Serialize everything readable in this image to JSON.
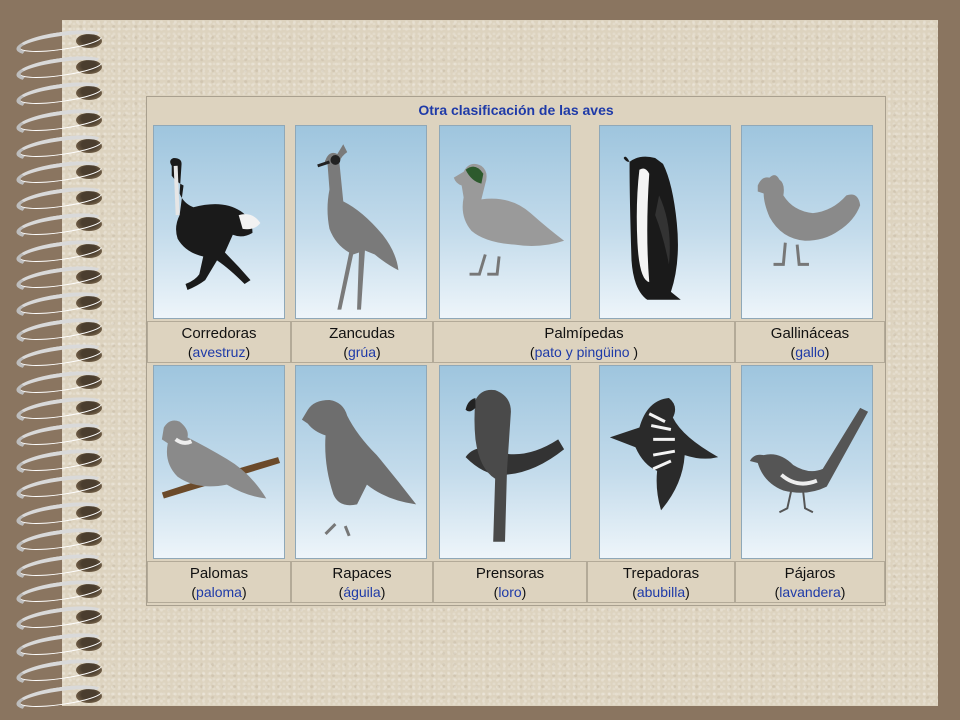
{
  "title": "Otra clasificación de las aves",
  "row1": [
    {
      "name": "Corredoras",
      "example": "avestruz",
      "icon": "ostrich-icon"
    },
    {
      "name": "Zancudas",
      "example": "grúa",
      "icon": "crane-icon"
    },
    {
      "name": "Palmípedas",
      "example": "pato y pingüino ",
      "icon": "duck-icon"
    },
    {
      "name": "Gallináceas",
      "example": "gallo",
      "icon": "rooster-icon"
    }
  ],
  "row1_extra_icon": "penguin-icon",
  "row2": [
    {
      "name": "Palomas",
      "example": "paloma",
      "icon": "pigeon-icon"
    },
    {
      "name": "Rapaces",
      "example": "águila",
      "icon": "eagle-icon"
    },
    {
      "name": "Prensoras",
      "example": "loro",
      "icon": "parrot-icon"
    },
    {
      "name": "Trepadoras",
      "example": "abubilla",
      "icon": "hoopoe-icon"
    },
    {
      "name": "Pájaros",
      "example": "lavandera",
      "icon": "wagtail-icon"
    }
  ],
  "colors": {
    "title": "#1e3aa8",
    "example_link": "#1e3aa8",
    "background": "#8a7560",
    "paper": "#ddd3bf"
  }
}
